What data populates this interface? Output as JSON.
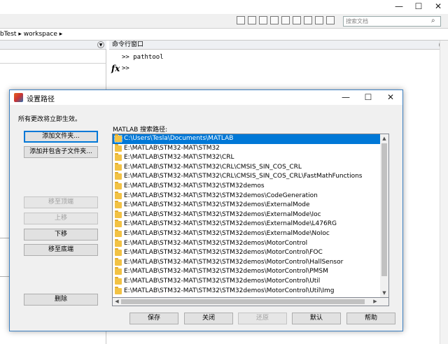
{
  "background": {
    "window_controls": [
      "—",
      "☐",
      "✕"
    ],
    "search_placeholder": "搜索文档",
    "address": {
      "segment1": "bTest",
      "sep": "▸",
      "segment2": "workspace",
      "sep2": "▸"
    },
    "command_window": {
      "title": "命令行窗口",
      "lines": [
        ">> pathtool"
      ],
      "fx": "fx",
      "prompt": ">>"
    }
  },
  "dialog": {
    "title": "设置路径",
    "controls": {
      "minimize": "—",
      "maximize": "☐",
      "close": "✕"
    },
    "note": "所有更改将立即生效。",
    "path_label": "MATLAB 搜索路径:",
    "left_buttons": {
      "add_folder": "添加文件夹...",
      "add_with_subfolders": "添加并包含子文件夹...",
      "move_to_top": "移至顶端",
      "move_up": "上移",
      "move_down": "下移",
      "move_to_bottom": "移至底端",
      "remove": "删除"
    },
    "paths": [
      "C:\\Users\\Tesla\\Documents\\MATLAB",
      "E:\\MATLAB\\STM32-MAT\\STM32",
      "E:\\MATLAB\\STM32-MAT\\STM32\\CRL",
      "E:\\MATLAB\\STM32-MAT\\STM32\\CRL\\CMSIS_SIN_COS_CRL",
      "E:\\MATLAB\\STM32-MAT\\STM32\\CRL\\CMSIS_SIN_COS_CRL\\FastMathFunctions",
      "E:\\MATLAB\\STM32-MAT\\STM32\\STM32demos",
      "E:\\MATLAB\\STM32-MAT\\STM32\\STM32demos\\CodeGeneration",
      "E:\\MATLAB\\STM32-MAT\\STM32\\STM32demos\\ExternalMode",
      "E:\\MATLAB\\STM32-MAT\\STM32\\STM32demos\\ExternalMode\\Ioc",
      "E:\\MATLAB\\STM32-MAT\\STM32\\STM32demos\\ExternalMode\\L476RG",
      "E:\\MATLAB\\STM32-MAT\\STM32\\STM32demos\\ExternalMode\\NoIoc",
      "E:\\MATLAB\\STM32-MAT\\STM32\\STM32demos\\MotorControl",
      "E:\\MATLAB\\STM32-MAT\\STM32\\STM32demos\\MotorControl\\FOC",
      "E:\\MATLAB\\STM32-MAT\\STM32\\STM32demos\\MotorControl\\HallSensor",
      "E:\\MATLAB\\STM32-MAT\\STM32\\STM32demos\\MotorControl\\PMSM",
      "E:\\MATLAB\\STM32-MAT\\STM32\\STM32demos\\MotorControl\\Util",
      "E:\\MATLAB\\STM32-MAT\\STM32\\STM32demos\\MotorControl\\Util\\Img"
    ],
    "bottom_buttons": {
      "save": "保存",
      "close": "关闭",
      "revert": "还原",
      "default": "默认",
      "help": "帮助"
    },
    "scroll_arrows": {
      "up": "▲",
      "down": "▼",
      "left": "◀",
      "right": "▶"
    }
  },
  "colors": {
    "selection": "#0078d7",
    "folder": "#f2c244",
    "dialog_border": "#3c7fc0"
  }
}
